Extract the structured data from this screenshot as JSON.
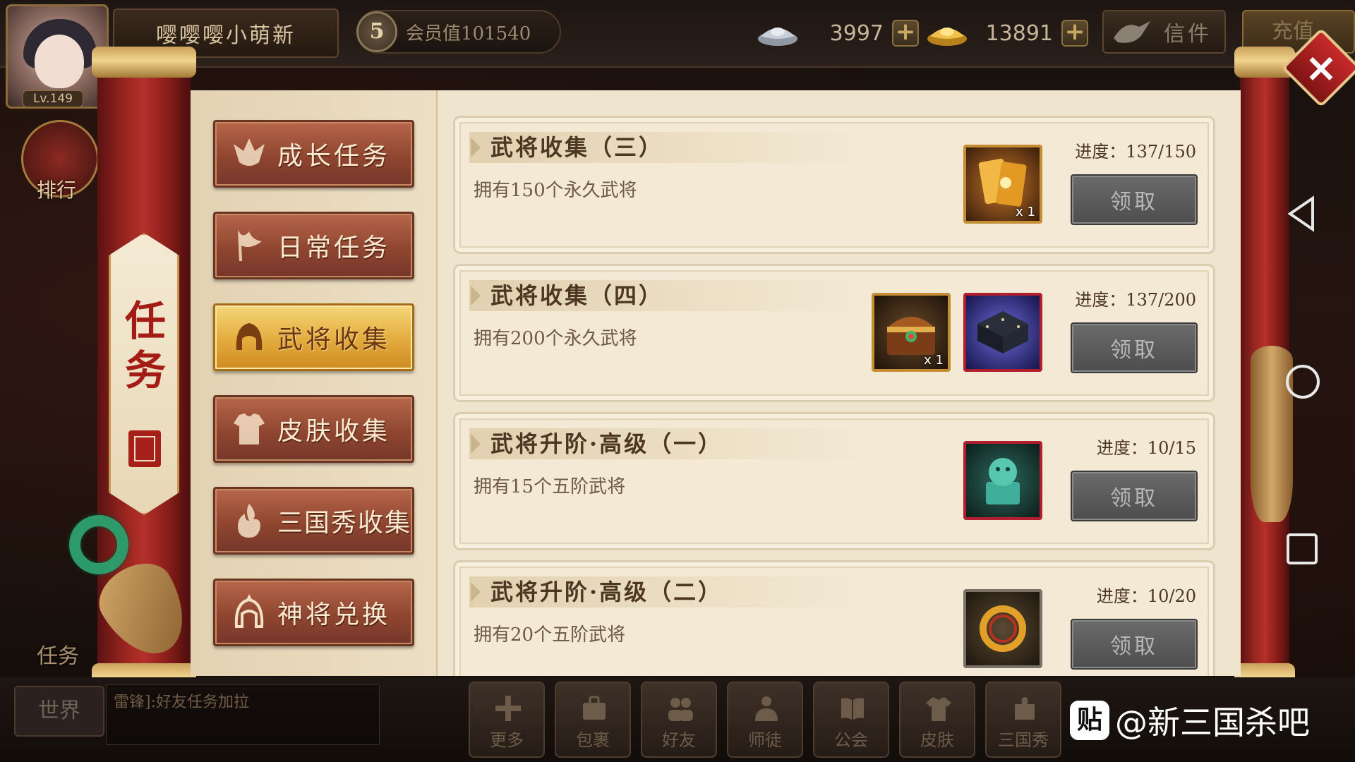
{
  "player": {
    "name": "嘤嘤嘤小萌新",
    "level": "Lv.149",
    "vip_level": "5",
    "vip_text": "会员值101540"
  },
  "currency": {
    "silver": "3997",
    "gold": "13891",
    "mail_label": "信件",
    "recharge_label": "充值"
  },
  "side": {
    "rank_label": "排行",
    "task_label": "任务"
  },
  "panel": {
    "title": "任务",
    "tabs": [
      {
        "label": "成长任务",
        "icon": "growth-icon",
        "active": false
      },
      {
        "label": "日常任务",
        "icon": "flag-icon",
        "active": false
      },
      {
        "label": "武将收集",
        "icon": "helmet-icon",
        "active": true
      },
      {
        "label": "皮肤收集",
        "icon": "armor-icon",
        "active": false
      },
      {
        "label": "三国秀收集",
        "icon": "flame-icon",
        "active": false
      },
      {
        "label": "神将兑换",
        "icon": "divine-general-icon",
        "active": false
      }
    ],
    "quests": [
      {
        "title": "武将收集（三）",
        "desc": "拥有150个永久武将",
        "progress": "进度：137/150",
        "claim": "领取",
        "rewards": [
          {
            "icon": "gold-card-icon",
            "count": "x 1",
            "frame": "gold"
          }
        ]
      },
      {
        "title": "武将收集（四）",
        "desc": "拥有200个永久武将",
        "progress": "进度：137/200",
        "claim": "领取",
        "rewards": [
          {
            "icon": "treasure-chest-icon",
            "count": "x 1",
            "frame": "gold"
          },
          {
            "icon": "frame-decoration-icon",
            "count": "",
            "frame": "red"
          }
        ]
      },
      {
        "title": "武将升阶·高级（一）",
        "desc": "拥有15个五阶武将",
        "progress": "进度：10/15",
        "claim": "领取",
        "rewards": [
          {
            "icon": "jade-lion-seal-icon",
            "count": "",
            "frame": "red"
          }
        ]
      },
      {
        "title": "武将升阶·高级（二）",
        "desc": "拥有20个五阶武将",
        "progress": "进度：10/20",
        "claim": "领取",
        "rewards": [
          {
            "icon": "dragon-ring-icon",
            "count": "",
            "frame": "gray"
          }
        ]
      }
    ]
  },
  "chat": {
    "world_label": "世界",
    "message": "雷锋]:好友任务加拉"
  },
  "bottom_nav": [
    {
      "label": "更多",
      "icon": "plus-icon"
    },
    {
      "label": "包裹",
      "icon": "bag-icon"
    },
    {
      "label": "好友",
      "icon": "friends-icon"
    },
    {
      "label": "师徒",
      "icon": "mentor-icon"
    },
    {
      "label": "公会",
      "icon": "book-icon"
    },
    {
      "label": "皮肤",
      "icon": "shirt-icon"
    },
    {
      "label": "三国秀",
      "icon": "puzzle-icon"
    }
  ],
  "watermark": {
    "badge": "贴",
    "text": "@新三国杀吧"
  }
}
